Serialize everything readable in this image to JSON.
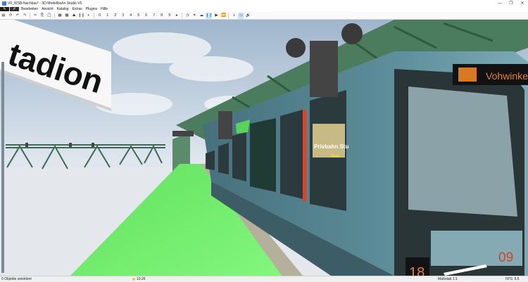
{
  "window": {
    "title": "V6_WSB-Nachbau* - 3D-Modellbahn Studio V6",
    "minimize": "—",
    "maximize": "❐",
    "close": "✕"
  },
  "menubar": {
    "items": [
      "Bearbeiten",
      "Ansicht",
      "Katalog",
      "Extras",
      "Plugins",
      "Hilfe"
    ]
  },
  "toolbar": {
    "numbers": [
      "0",
      "1",
      "2",
      "3",
      "4",
      "5",
      "6",
      "7",
      "8",
      "9"
    ]
  },
  "scene": {
    "sign_text": "tadion",
    "destination": "Vohwinkel",
    "line_number": "18",
    "car_number": "09",
    "ad_text_1": "Privbahn Stu",
    "ad_text_2": "Sim"
  },
  "status": {
    "selection": "0 Objekte selektiert",
    "time": "13:26",
    "scale": "Maßstab 1:1",
    "fps": "FPS: 9,5"
  },
  "colors": {
    "train_body": "#5e8c98",
    "platform": "#6ef06a",
    "steel_green": "#3f7a5a",
    "sky": "#c9d8e8",
    "destination_text": "#e0832a"
  }
}
